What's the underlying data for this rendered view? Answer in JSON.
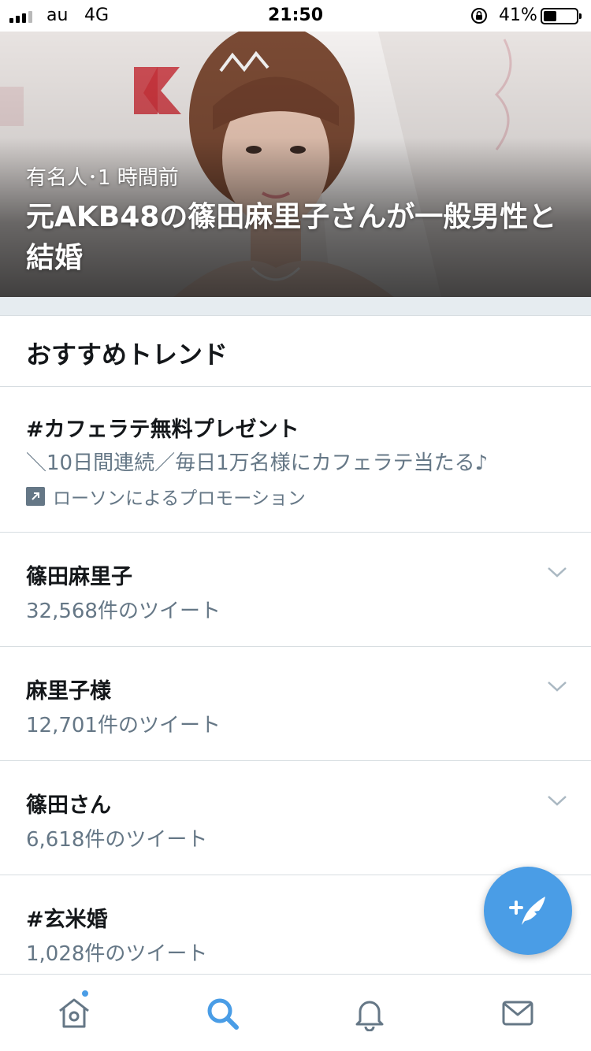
{
  "status_bar": {
    "carrier": "au",
    "network": "4G",
    "time": "21:50",
    "battery_percent": "41%",
    "battery_level": 0.41
  },
  "hero": {
    "meta": "有名人･1 時間前",
    "headline": "元AKB48の篠田麻里子さんが一般男性と結婚"
  },
  "section": {
    "title": "おすすめトレンド"
  },
  "promoted_trend": {
    "name": "#カフェラテ無料プレゼント",
    "description": "＼10日間連続／毎日1万名様にカフェラテ当たる♪",
    "promoted_by": "ローソンによるプロモーション",
    "icon": "promoted-arrow-icon"
  },
  "trends": [
    {
      "name": "篠田麻里子",
      "count": "32,568件のツイート"
    },
    {
      "name": "麻里子様",
      "count": "12,701件のツイート"
    },
    {
      "name": "篠田さん",
      "count": "6,618件のツイート"
    },
    {
      "name": "#玄米婚",
      "count": "1,028件のツイート"
    }
  ],
  "fab": {
    "icon": "compose-tweet-icon"
  },
  "tab_bar": {
    "tabs": [
      {
        "name": "home",
        "icon": "home-icon",
        "active": false,
        "has_badge": true
      },
      {
        "name": "search",
        "icon": "search-icon",
        "active": true,
        "has_badge": false
      },
      {
        "name": "notifications",
        "icon": "bell-icon",
        "active": false,
        "has_badge": false
      },
      {
        "name": "messages",
        "icon": "envelope-icon",
        "active": false,
        "has_badge": false
      }
    ]
  },
  "colors": {
    "accent": "#4a9de6",
    "secondary_text": "#657786",
    "divider": "#d7dde1"
  }
}
